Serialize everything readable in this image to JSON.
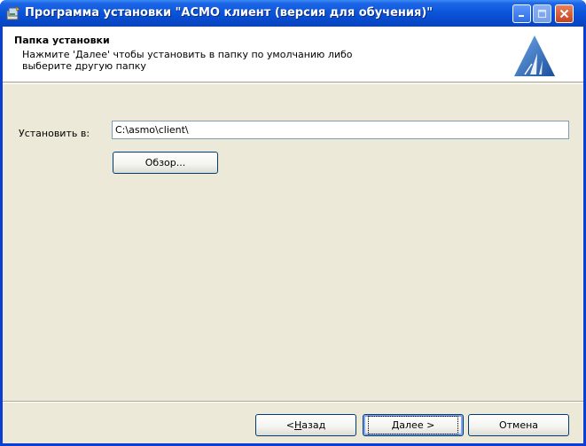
{
  "window": {
    "title": "Программа установки \"АСМО клиент (версия для обучения)\"",
    "colors": {
      "titlebar": "#0a56dc",
      "client": "#ece9d8",
      "close": "#c6441e"
    }
  },
  "header": {
    "title": "Папка установки",
    "description": "Нажмите 'Далее' чтобы установить в папку по умолчанию либо\nвыберите другую папку",
    "logo_icon": "asmo-logo-icon"
  },
  "form": {
    "install_label": "Установить в:",
    "install_path": "C:\\asmo\\client\\",
    "browse_label": "Обзор..."
  },
  "buttons": {
    "back_prefix": "< ",
    "back_mnemonic": "Н",
    "back_rest": "азад",
    "next_mnemonic": "Д",
    "next_rest": "алее >",
    "cancel": "Отмена"
  }
}
